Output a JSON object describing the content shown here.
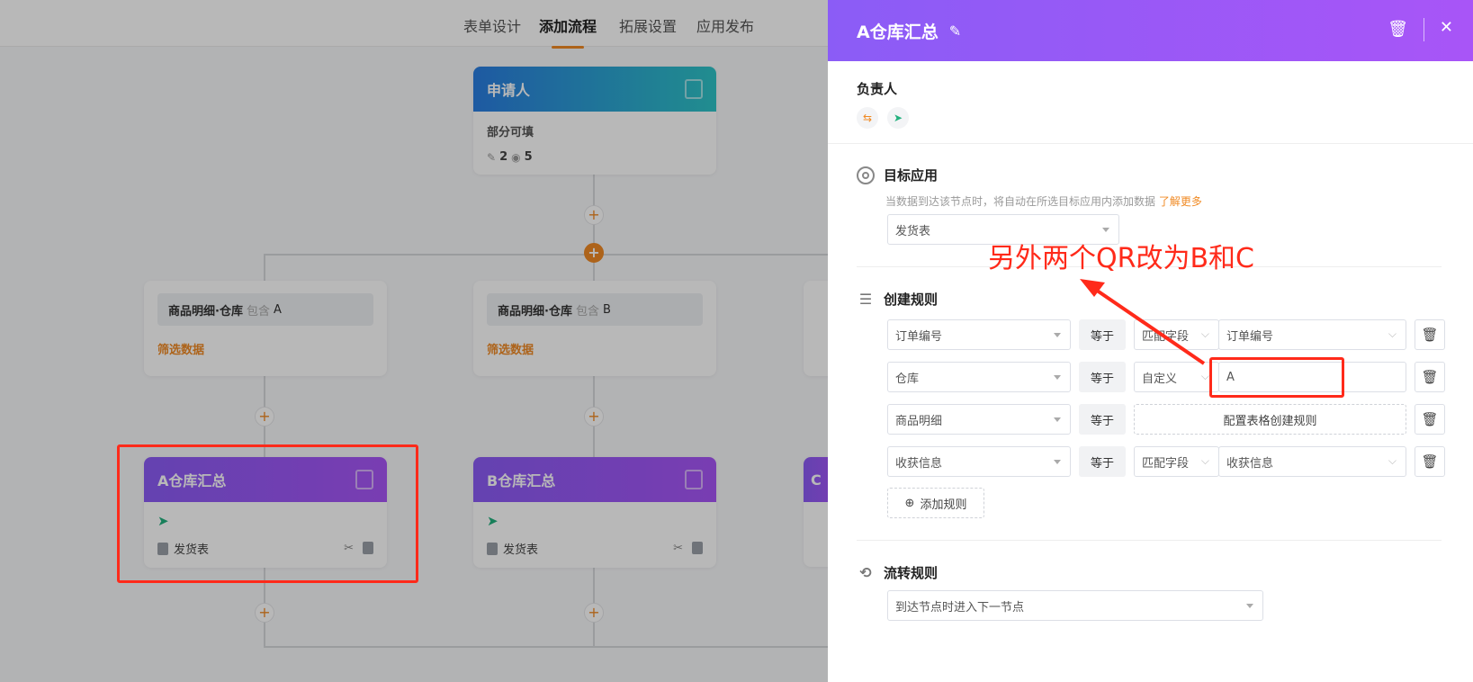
{
  "nav": {
    "tabs": [
      {
        "label": "表单设计"
      },
      {
        "label": "添加流程"
      },
      {
        "label": "拓展设置"
      },
      {
        "label": "应用发布"
      }
    ]
  },
  "flow": {
    "applicant": {
      "title": "申请人",
      "subtitle": "部分可填",
      "edit_count": "2",
      "view_count": "5"
    },
    "filters": [
      {
        "field": "商品明细·仓库",
        "op": "包含",
        "value": "A",
        "link": "筛选数据"
      },
      {
        "field": "商品明细·仓库",
        "op": "包含",
        "value": "B",
        "link": "筛选数据"
      }
    ],
    "nodes": [
      {
        "title": "A仓库汇总",
        "doc": "发货表"
      },
      {
        "title": "B仓库汇总",
        "doc": "发货表"
      }
    ],
    "partial_node_letter": "C"
  },
  "panel": {
    "title": "A仓库汇总",
    "owner_label": "负责人",
    "target": {
      "title": "目标应用",
      "hint": "当数据到达该节点时，将自动在所选目标应用内添加数据",
      "more": "了解更多",
      "value": "发货表"
    },
    "rules": {
      "title": "创建规则",
      "rows": [
        {
          "field": "订单编号",
          "op": "等于",
          "mode": "匹配字段",
          "value": "订单编号"
        },
        {
          "field": "仓库",
          "op": "等于",
          "mode": "自定义",
          "value": "A"
        },
        {
          "field": "商品明细",
          "op": "等于",
          "config": "配置表格创建规则"
        },
        {
          "field": "收获信息",
          "op": "等于",
          "mode": "匹配字段",
          "value": "收获信息"
        }
      ],
      "add_label": "添加规则"
    },
    "transfer": {
      "title": "流转规则",
      "value": "到达节点时进入下一节点"
    }
  },
  "annotation": {
    "text": "另外两个QR改为B和C",
    "color": "#ff2a1a"
  },
  "colors": {
    "accent": "#f08a24",
    "header_purple": "#8b5cf6",
    "applicant_blue": "#2a7de1",
    "green": "#22b07d"
  }
}
